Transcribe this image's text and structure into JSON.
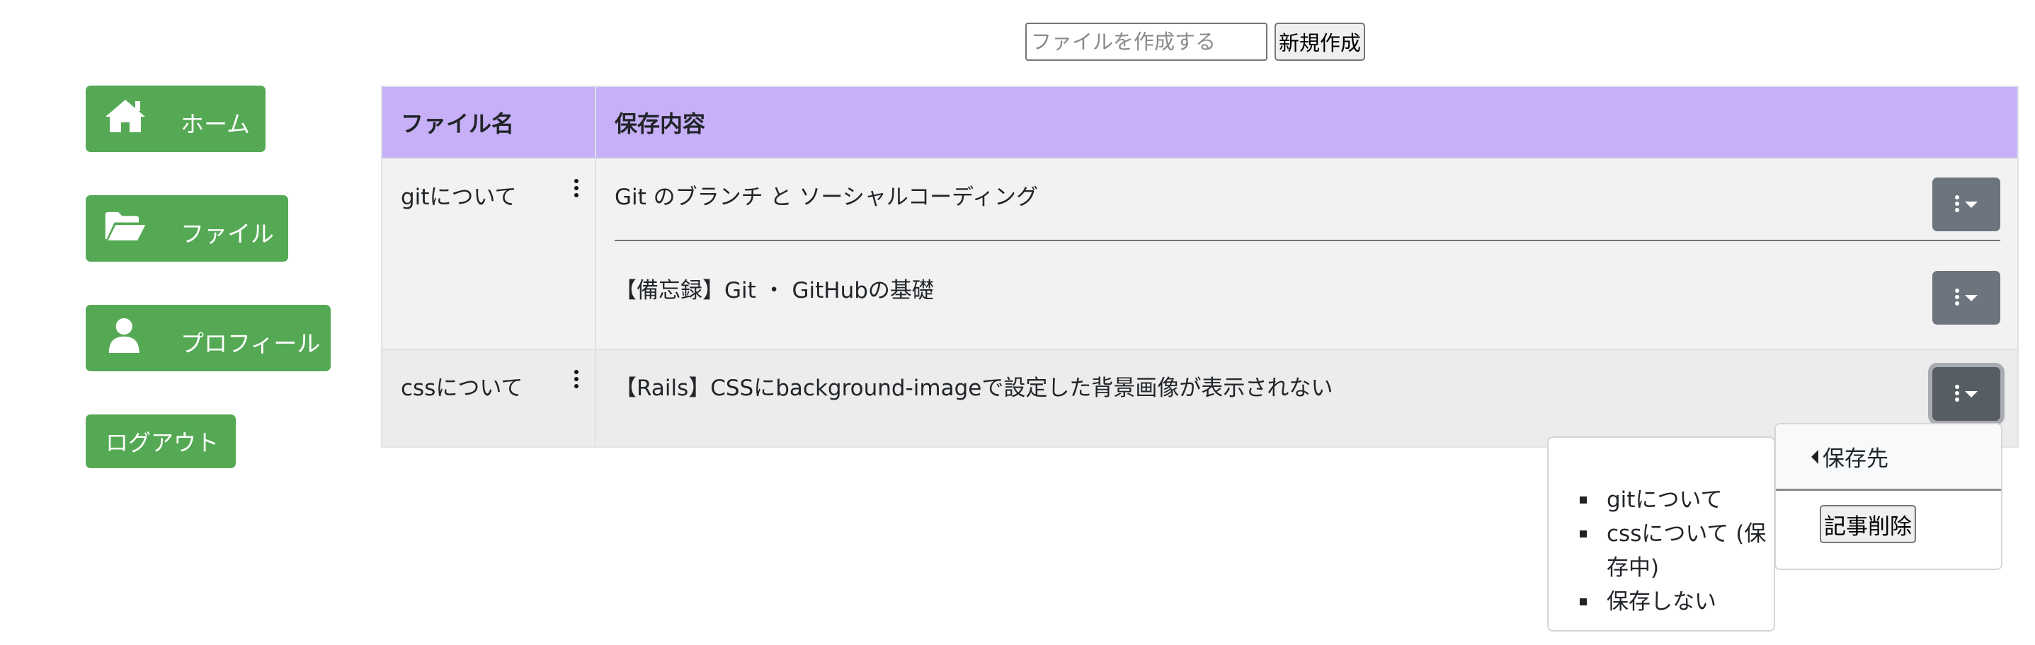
{
  "create": {
    "placeholder": "ファイルを作成する",
    "button": "新規作成"
  },
  "sidebar": {
    "home": "ホーム",
    "file": "ファイル",
    "profile": "プロフィール",
    "logout": "ログアウト"
  },
  "table": {
    "headers": {
      "name": "ファイル名",
      "content": "保存内容"
    },
    "rows": [
      {
        "name": "gitについて",
        "articles": [
          "Git のブランチ と ソーシャルコーディング",
          "【備忘録】Git ・ GitHubの基礎"
        ]
      },
      {
        "name": "cssについて",
        "articles": [
          "【Rails】CSSにbackground-imageで設定した背景画像が表示されない"
        ]
      }
    ]
  },
  "dropdown": {
    "save_to": "保存先",
    "delete": "記事削除",
    "folders": [
      "gitについて",
      "cssについて (保存中)",
      "保存しない"
    ]
  },
  "colors": {
    "nav_green": "#55a954",
    "header_purple": "#c7b0f8",
    "button_gray": "#6c757d"
  },
  "icons": [
    "home-icon",
    "folder-open-icon",
    "user-icon",
    "kebab-icon",
    "caret-down-icon",
    "caret-left-icon"
  ]
}
